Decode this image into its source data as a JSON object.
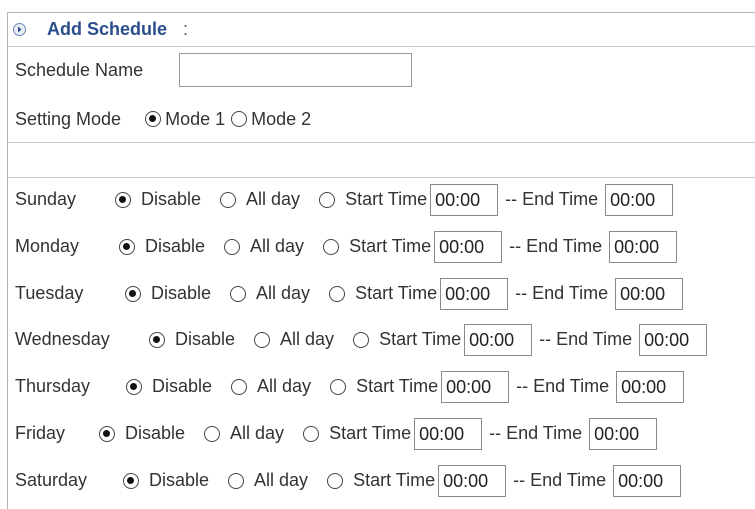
{
  "header": {
    "title": "Add Schedule",
    "colon": ":"
  },
  "schedule_name": {
    "label": "Schedule Name",
    "value": ""
  },
  "setting_mode": {
    "label": "Setting Mode",
    "options": [
      {
        "label": "Mode 1",
        "checked": true
      },
      {
        "label": "Mode 2",
        "checked": false
      }
    ]
  },
  "days": [
    {
      "name": "Sunday",
      "disable": "Disable",
      "allday": "All day",
      "start_label": "Start Time",
      "start": "00:00",
      "end_label": "-- End Time",
      "end": "00:00"
    },
    {
      "name": "Monday",
      "disable": "Disable",
      "allday": "All day",
      "start_label": "Start Time",
      "start": "00:00",
      "end_label": "-- End Time",
      "end": "00:00"
    },
    {
      "name": "Tuesday",
      "disable": "Disable",
      "allday": "All day",
      "start_label": "Start Time",
      "start": "00:00",
      "end_label": "-- End Time",
      "end": "00:00"
    },
    {
      "name": "Wednesday",
      "disable": "Disable",
      "allday": "All day",
      "start_label": "Start Time",
      "start": "00:00",
      "end_label": "-- End Time",
      "end": "00:00"
    },
    {
      "name": "Thursday",
      "disable": "Disable",
      "allday": "All day",
      "start_label": "Start Time",
      "start": "00:00",
      "end_label": "-- End Time",
      "end": "00:00"
    },
    {
      "name": "Friday",
      "disable": "Disable",
      "allday": "All day",
      "start_label": "Start Time",
      "start": "00:00",
      "end_label": "-- End Time",
      "end": "00:00"
    },
    {
      "name": "Saturday",
      "disable": "Disable",
      "allday": "All day",
      "start_label": "Start Time",
      "start": "00:00",
      "end_label": "-- End Time",
      "end": "00:00"
    }
  ],
  "colors": {
    "title": "#2b4e8c",
    "text": "#333333",
    "border": "#b5b5b5"
  }
}
